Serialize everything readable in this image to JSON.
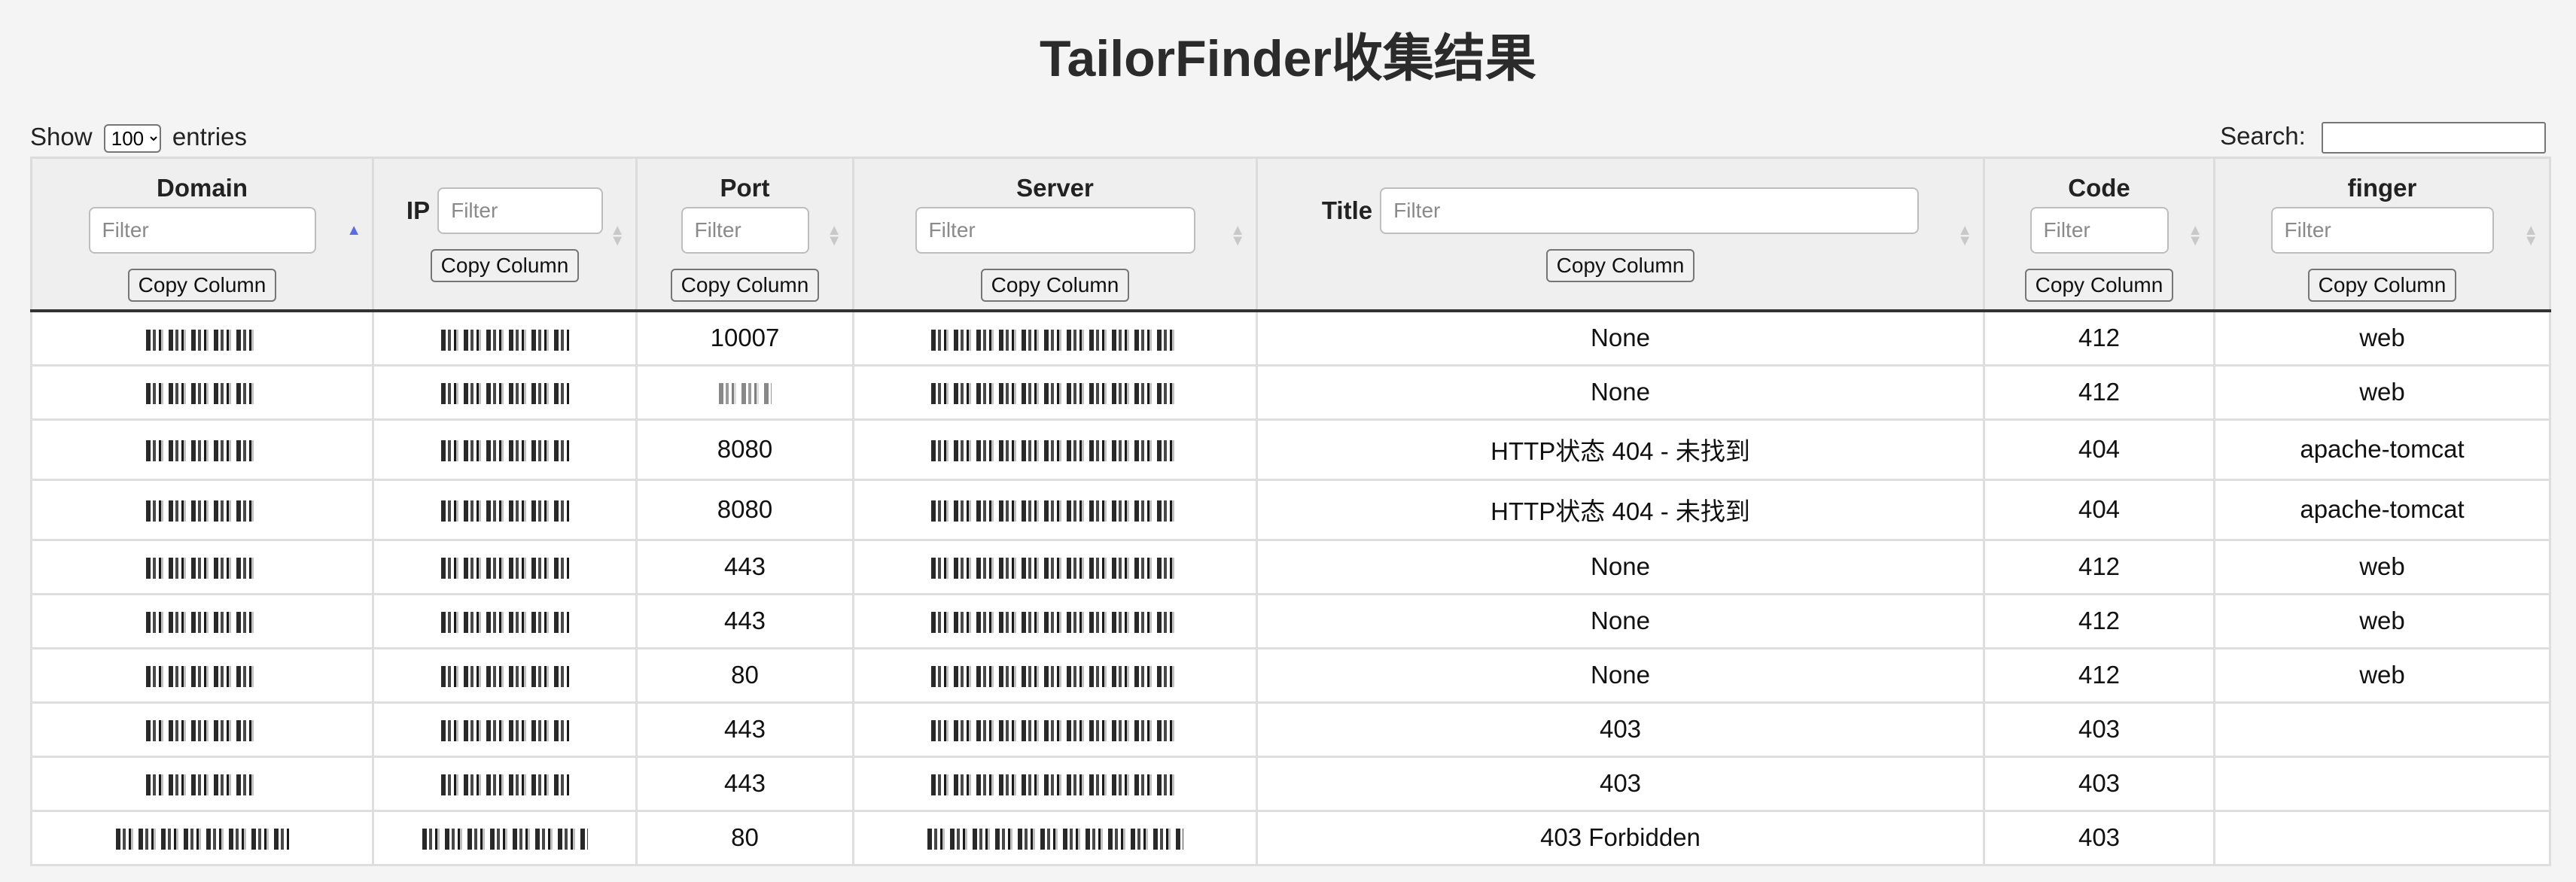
{
  "page": {
    "title": "TailorFinder收集结果"
  },
  "controls": {
    "show_label": "Show",
    "entries_value": "100",
    "entries_label": "entries",
    "search_label": "Search:",
    "search_value": ""
  },
  "table": {
    "columns": [
      {
        "name": "Domain",
        "filter_placeholder": "Filter",
        "copy_label": "Copy Column",
        "sorted": "asc"
      },
      {
        "name": "IP",
        "filter_placeholder": "Filter",
        "copy_label": "Copy Column"
      },
      {
        "name": "Port",
        "filter_placeholder": "Filter",
        "copy_label": "Copy Column"
      },
      {
        "name": "Server",
        "filter_placeholder": "Filter",
        "copy_label": "Copy Column"
      },
      {
        "name": "Title",
        "filter_placeholder": "Filter",
        "copy_label": "Copy Column"
      },
      {
        "name": "Code",
        "filter_placeholder": "Filter",
        "copy_label": "Copy Column"
      },
      {
        "name": "finger",
        "filter_placeholder": "Filter",
        "copy_label": "Copy Column"
      }
    ],
    "redacted_note": "Domain, IP and Server values are pixelated/redacted in the screenshot",
    "rows": [
      {
        "port": "10007",
        "title": "None",
        "code": "412",
        "finger": "web"
      },
      {
        "port": "",
        "title": "None",
        "code": "412",
        "finger": "web"
      },
      {
        "port": "8080",
        "title": "HTTP状态 404 - 未找到",
        "code": "404",
        "finger": "apache-tomcat"
      },
      {
        "port": "8080",
        "title": "HTTP状态 404 - 未找到",
        "code": "404",
        "finger": "apache-tomcat"
      },
      {
        "port": "443",
        "title": "None",
        "code": "412",
        "finger": "web"
      },
      {
        "port": "443",
        "title": "None",
        "code": "412",
        "finger": "web"
      },
      {
        "port": "80",
        "title": "None",
        "code": "412",
        "finger": "web"
      },
      {
        "port": "443",
        "title": "403",
        "code": "403",
        "finger": ""
      },
      {
        "port": "443",
        "title": "403",
        "code": "403",
        "finger": ""
      },
      {
        "port": "80",
        "title": "403 Forbidden",
        "code": "403",
        "finger": ""
      }
    ]
  },
  "colors": {
    "page_bg": "#f4f4f4",
    "header_bg": "#efefef",
    "sort_active": "#5a6ee0"
  }
}
